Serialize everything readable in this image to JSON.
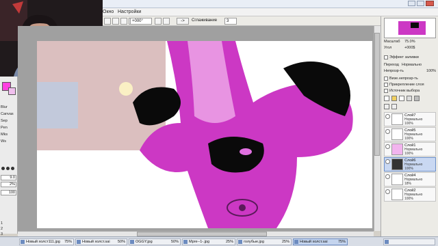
{
  "menu": {
    "window_label": "Окно",
    "settings_label": "Настройки"
  },
  "toolbar": {
    "rotation_value": "+000°",
    "arrow_button": "->",
    "smoothing_label": "Сглаживание",
    "smoothing_value": "3"
  },
  "left_panel": {
    "labels": [
      "Blur",
      "Canvas",
      "Sep",
      "Pen",
      "Mks",
      "Ws"
    ],
    "size_value": "9.0",
    "percent_value": "2%",
    "density_value": "100",
    "scale_marks": [
      "1",
      "2",
      "3"
    ]
  },
  "navigator": {
    "zoom_label": "Масштаб",
    "zoom_value": "75.0%",
    "angle_label": "Угол",
    "angle_value": "+000$"
  },
  "layer_props": {
    "effects_label": "Эффект заливки",
    "blend_label": "Переход",
    "blend_value": "Нормально",
    "opacity_label": "Непрозр-ть",
    "opacity_value": "100%",
    "checks": [
      "Визе.непрозр-ть",
      "Прикрепление слоя",
      "Источник выбора"
    ]
  },
  "layers": [
    {
      "name": "Слой7",
      "mode": "Нормально",
      "opacity": "100%",
      "selected": false
    },
    {
      "name": "Слой5",
      "mode": "Нормально",
      "opacity": "100%",
      "selected": false
    },
    {
      "name": "Слой1",
      "mode": "Нормально",
      "opacity": "100%",
      "selected": false
    },
    {
      "name": "Слой6",
      "mode": "Нормально",
      "opacity": "100%",
      "selected": true
    },
    {
      "name": "Слой4",
      "mode": "Нормально",
      "opacity": "18%",
      "selected": false
    },
    {
      "name": "Слой2",
      "mode": "Нормально",
      "opacity": "100%",
      "selected": false
    }
  ],
  "tabs": [
    {
      "name": "Новый холст111.jpg",
      "zoom": "75%",
      "active": false
    },
    {
      "name": "Новый холст.sai",
      "zoom": "50%",
      "active": false
    },
    {
      "name": "OGGY.jpg",
      "zoom": "50%",
      "active": false
    },
    {
      "name": "Мрге--1-.jpg",
      "zoom": "25%",
      "active": false
    },
    {
      "name": "голубые.jpg",
      "zoom": "25%",
      "active": false
    },
    {
      "name": "Новый холст.sai",
      "zoom": "75%",
      "active": true
    },
    {
      "name": "",
      "zoom": "",
      "active": false
    }
  ],
  "colors": {
    "accent_magenta": "#e040c8",
    "primary_swatch": "#ff40e0",
    "selection_blue": "#c9d8f2"
  }
}
